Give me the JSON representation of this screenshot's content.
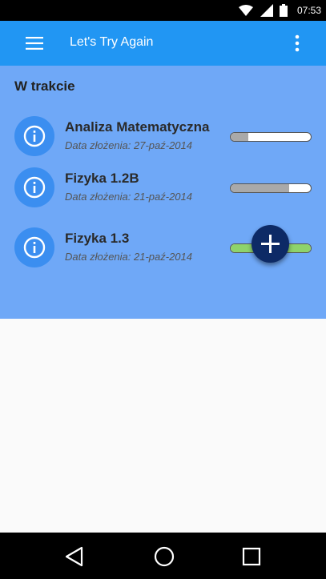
{
  "status_bar": {
    "time": "07:53",
    "icons": [
      "wifi-icon",
      "signal-icon",
      "battery-icon"
    ]
  },
  "app_bar": {
    "title": "Let's Try Again",
    "menu_icon": "hamburger-menu-icon",
    "overflow_icon": "more-vert-icon",
    "color": "#2196f3"
  },
  "section": {
    "title": "W trakcie",
    "background": "#6fa8f7"
  },
  "items": [
    {
      "title": "Analiza Matematyczna",
      "subtitle": "Data złożenia: 27-paź-2014",
      "progress": 0.22,
      "progress_color": "#a9a9a9",
      "icon": "info-icon"
    },
    {
      "title": "Fizyka 1.2B",
      "subtitle": "Data złożenia: 21-paź-2014",
      "progress": 0.73,
      "progress_color": "#a9a9a9",
      "icon": "info-icon"
    },
    {
      "title": "Fizyka 1.3",
      "subtitle": "Data złożenia: 21-paź-2014",
      "progress": 1.0,
      "progress_color": "#8ed36b",
      "icon": "info-icon"
    }
  ],
  "fab": {
    "icon": "plus-icon",
    "color": "#0d2a66"
  },
  "nav_bar": {
    "icons": [
      "back-icon",
      "home-icon",
      "recents-icon"
    ]
  }
}
